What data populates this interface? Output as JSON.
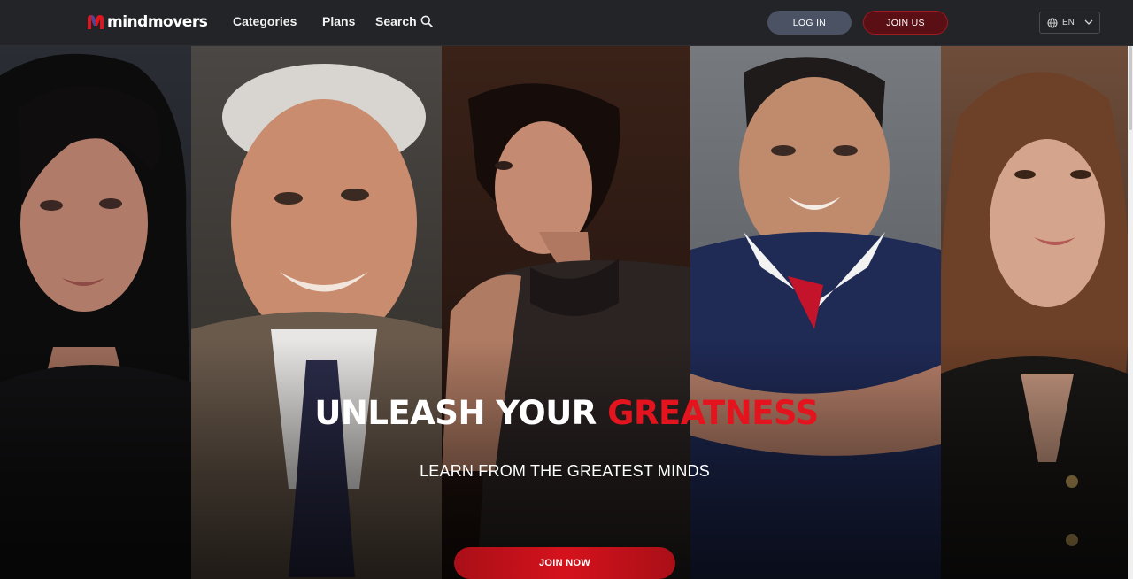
{
  "brand": {
    "name": "mindmovers",
    "accent_color": "#e3141d",
    "logo_icon": "mindmovers-logo-icon"
  },
  "nav": {
    "categories": "Categories",
    "plans": "Plans",
    "search": "Search",
    "search_icon": "search-icon"
  },
  "auth": {
    "login": "LOG IN",
    "join": "JOIN US"
  },
  "language": {
    "selected": "EN",
    "icon": "globe-icon",
    "caret": "chevron-down-icon"
  },
  "hero": {
    "headline_white": "UNLEASH YOUR ",
    "headline_red": "GREATNESS",
    "subheadline": "LEARN FROM THE GREATEST MINDS",
    "cta": "JOIN NOW",
    "portraits": [
      "portrait-1",
      "portrait-2",
      "portrait-3",
      "portrait-4",
      "portrait-5"
    ]
  },
  "colors": {
    "topbar": "#232428",
    "login_button": "#4a5263",
    "join_button": "#5a0f14",
    "cta": "#d5121c"
  }
}
